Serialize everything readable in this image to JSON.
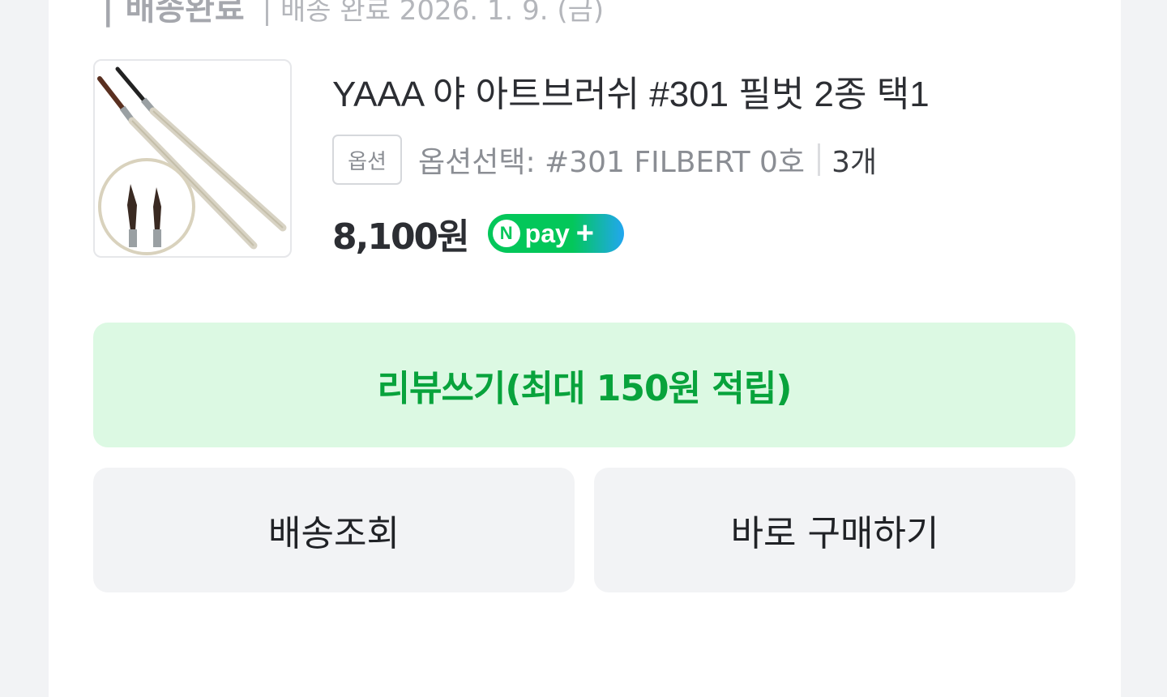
{
  "order_status": {
    "title": "| 배송완료",
    "date_text": "| 배송 완료 2026. 1. 9. (금)"
  },
  "product": {
    "image_icon": "paintbrush-product-photo",
    "title": "YAAA 야 아트브러쉬 #301 필벗 2종 택1",
    "option_badge": "옵션",
    "option_text": "옵션선택: #301 FILBERT 0호",
    "quantity": "3개",
    "price": "8,100원"
  },
  "npay": {
    "n": "N",
    "pay": "pay",
    "plus": "+",
    "colors": {
      "green": "#03c75a",
      "blue": "#22a6f0"
    }
  },
  "actions": {
    "review_label": "리뷰쓰기(최대 150원 적립)",
    "track_label": "배송조회",
    "buy_label": "바로 구매하기"
  },
  "colors": {
    "review_bg": "#dcf9e3",
    "review_text": "#08a33c",
    "button_bg": "#f2f3f5"
  }
}
